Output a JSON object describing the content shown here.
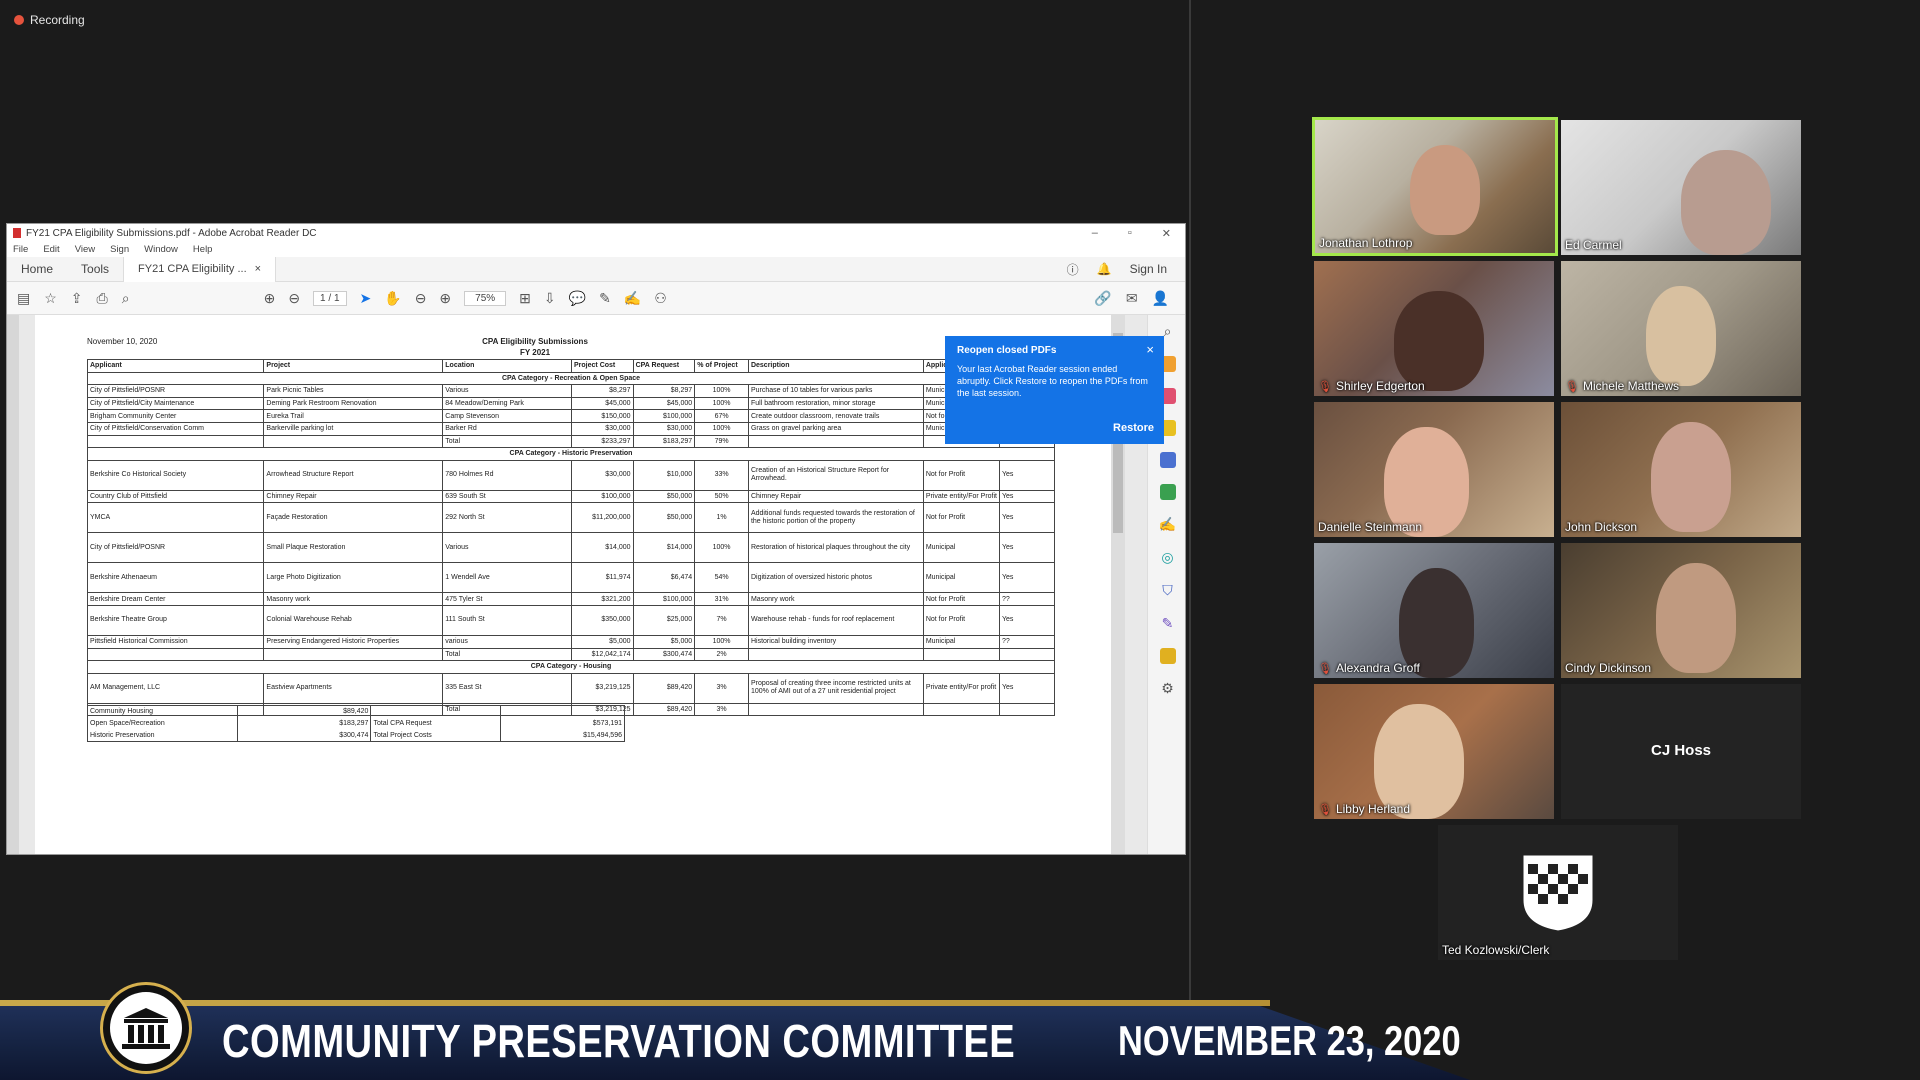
{
  "recording": {
    "label": "Recording"
  },
  "acrobat": {
    "window_title": "FY21 CPA Eligibility Submissions.pdf - Adobe Acrobat Reader DC",
    "menu": [
      "File",
      "Edit",
      "View",
      "Sign",
      "Window",
      "Help"
    ],
    "tabs": {
      "home": "Home",
      "tools": "Tools",
      "doc": "FY21 CPA Eligibility ...",
      "doc_close": "×",
      "sign_in": "Sign In"
    },
    "page_indicator": "1 / 1",
    "zoom": "75%"
  },
  "pdf": {
    "date": "November 10, 2020",
    "title": "CPA Eligibility Submissions",
    "subtitle": "FY 2021",
    "headers": [
      "Applicant",
      "Project",
      "Location",
      "Project Cost",
      "CPA Request",
      "% of Project",
      "Description",
      "Applicant",
      ""
    ],
    "cat_open_space": "CPA Category - Recreation & Open Space",
    "open_space_rows": [
      [
        "City of Pittsfield/POSNR",
        "Park Picnic Tables",
        "Various",
        "$8,297",
        "$8,297",
        "100%",
        "Purchase of 10 tables for various parks",
        "Municipal",
        ""
      ],
      [
        "City of Pittsfield/City Maintenance",
        "Deming Park Restroom Renovation",
        "84 Meadow/Deming Park",
        "$45,000",
        "$45,000",
        "100%",
        "Full bathroom restoration, minor storage",
        "Municipal",
        ""
      ],
      [
        "Brigham Community Center",
        "Eureka Trail",
        "Camp Stevenson",
        "$150,000",
        "$100,000",
        "67%",
        "Create outdoor classroom, renovate trails",
        "Not for Pr",
        ""
      ],
      [
        "City of Pittsfield/Conservation Comm",
        "Barkerville parking lot",
        "Barker Rd",
        "$30,000",
        "$30,000",
        "100%",
        "Grass on gravel parking area",
        "Municipal",
        ""
      ],
      [
        "",
        "",
        "Total",
        "$233,297",
        "$183,297",
        "79%",
        "",
        "",
        ""
      ]
    ],
    "cat_historic": "CPA Category - Historic Preservation",
    "historic_rows": [
      [
        "Berkshire Co Historical Society",
        "Arrowhead Structure Report",
        "780 Holmes Rd",
        "$30,000",
        "$10,000",
        "33%",
        "Creation of an Historical Structure Report for Arrowhead.",
        "Not for Profit",
        "Yes"
      ],
      [
        "Country Club of Pittsfield",
        "Chimney Repair",
        "639 South St",
        "$100,000",
        "$50,000",
        "50%",
        "Chimney Repair",
        "Private entity/For Profit",
        "Yes"
      ],
      [
        "YMCA",
        "Façade Restoration",
        "292 North St",
        "$11,200,000",
        "$50,000",
        "1%",
        "Additional funds requested towards the restoration of the historic portion of the property",
        "Not for Profit",
        "Yes"
      ],
      [
        "City of Pittsfield/POSNR",
        "Small Plaque Restoration",
        "Various",
        "$14,000",
        "$14,000",
        "100%",
        "Restoration of historical plaques throughout the city",
        "Municipal",
        "Yes"
      ],
      [
        "Berkshire Athenaeum",
        "Large Photo Digitization",
        "1 Wendell Ave",
        "$11,974",
        "$6,474",
        "54%",
        "Digitization of oversized historic photos",
        "Municipal",
        "Yes"
      ],
      [
        "Berkshire Dream Center",
        "Masonry work",
        "475 Tyler St",
        "$321,200",
        "$100,000",
        "31%",
        "Masonry work",
        "Not for Profit",
        "??"
      ],
      [
        "Berkshire Theatre Group",
        "Colonial Warehouse Rehab",
        "111 South St",
        "$350,000",
        "$25,000",
        "7%",
        "Warehouse rehab - funds for roof replacement",
        "Not for Profit",
        "Yes"
      ],
      [
        "Pittsfield Historical Commission",
        "Preserving Endangered Historic Properties",
        "various",
        "$5,000",
        "$5,000",
        "100%",
        "Historical building inventory",
        "Municipal",
        "??"
      ],
      [
        "",
        "",
        "Total",
        "$12,042,174",
        "$300,474",
        "2%",
        "",
        "",
        ""
      ]
    ],
    "cat_housing": "CPA Category - Housing",
    "housing_rows": [
      [
        "AM Management, LLC",
        "Eastview Apartments",
        "335 East St",
        "$3,219,125",
        "$89,420",
        "3%",
        "Proposal of creating three income restricted units at 100% of AMI out of a 27 unit residential project",
        "Private entity/For profit",
        "Yes"
      ],
      [
        "",
        "",
        "Total",
        "$3,219,125",
        "$89,420",
        "3%",
        "",
        "",
        ""
      ]
    ],
    "summary": [
      [
        "Community Housing",
        "$89,420",
        "",
        ""
      ],
      [
        "Open Space/Recreation",
        "$183,297",
        "Total CPA Request",
        "$573,191"
      ],
      [
        "Historic Preservation",
        "$300,474",
        "Total Project Costs",
        "$15,494,596"
      ]
    ]
  },
  "popup": {
    "title": "Reopen closed PDFs",
    "body": "Your last Acrobat Reader session ended abruptly. Click Restore to reopen the PDFs from the last session.",
    "close": "×",
    "restore": "Restore"
  },
  "participants": {
    "p1": "Jonathan Lothrop",
    "p2": "Ed Carmel",
    "p3": "Shirley Edgerton",
    "p4": "Michele Matthews",
    "p5": "Danielle Steinmann",
    "p6": "John Dickson",
    "p7": "Alexandra Groff",
    "p8": "Cindy Dickinson",
    "p9": "Libby Herland",
    "p10": "CJ Hoss",
    "p11": "Ted Kozlowski/Clerk"
  },
  "banner": {
    "title": "COMMUNITY PRESERVATION COMMITTEE",
    "date": "NOVEMBER 23, 2020"
  },
  "colors": {
    "active_speaker": "#a4e84b",
    "popup_blue": "#1473e6",
    "banner_navy": "#1f3058",
    "banner_gold": "#c8a84a",
    "recording_red": "#e5533d"
  }
}
